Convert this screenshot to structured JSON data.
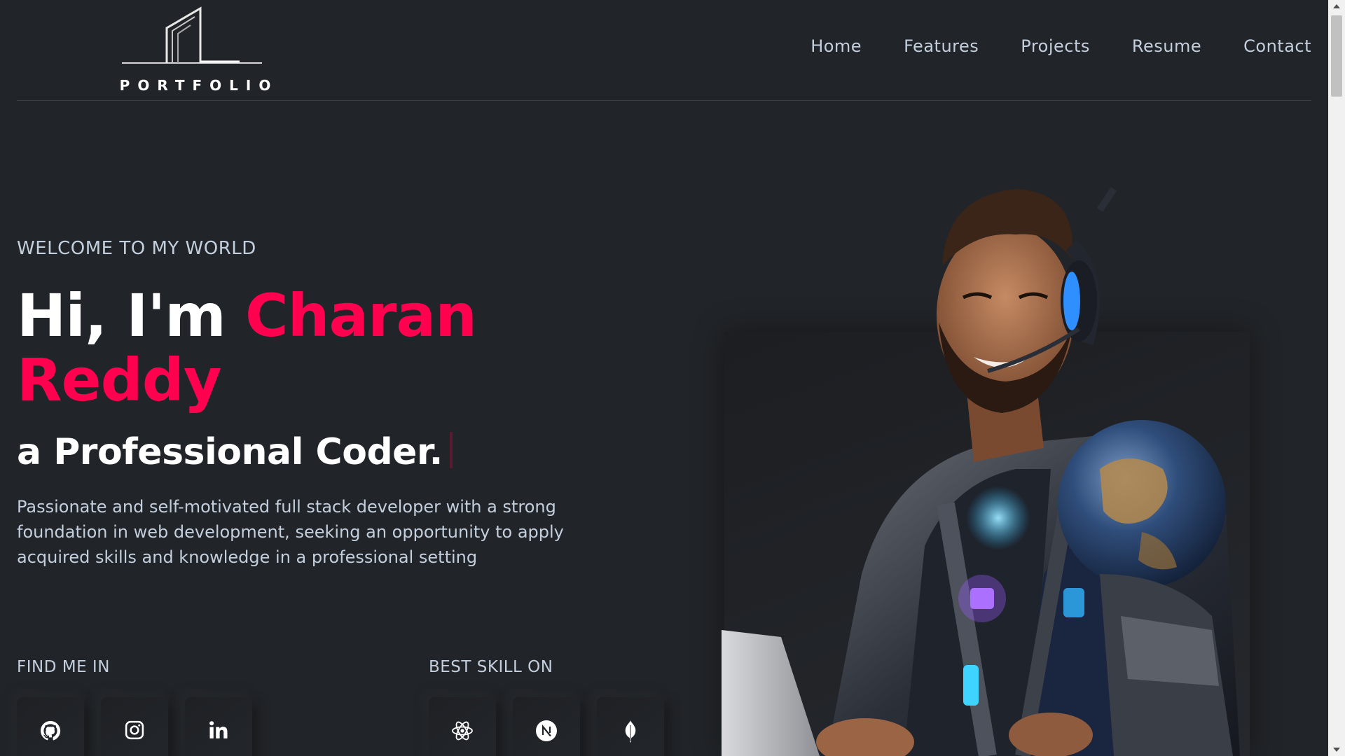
{
  "header": {
    "logo_text": "PORTFOLIO",
    "nav": [
      "Home",
      "Features",
      "Projects",
      "Resume",
      "Contact"
    ]
  },
  "hero": {
    "subtitle": "WELCOME TO MY WORLD",
    "greeting": "Hi, I'm ",
    "name": "Charan Reddy",
    "role": "a Professional Coder.",
    "bio": "Passionate and self-motivated full stack developer with a strong foundation in web development, seeking an opportunity to apply acquired skills and knowledge in a professional setting"
  },
  "social": {
    "label": "FIND ME IN",
    "icons": [
      "github-icon",
      "instagram-icon",
      "linkedin-icon"
    ]
  },
  "skills": {
    "label": "BEST SKILL ON",
    "icons": [
      "react-icon",
      "nextjs-icon",
      "mongodb-icon"
    ]
  },
  "colors": {
    "background": "#212428",
    "accent": "#ff014f",
    "text": "#c4cfde",
    "heading": "#ffffff"
  }
}
